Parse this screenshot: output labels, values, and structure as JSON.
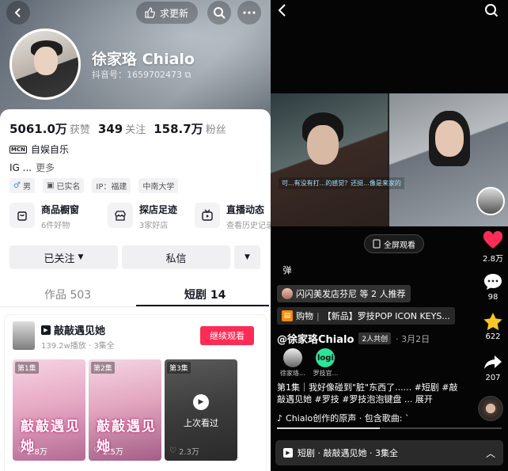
{
  "left": {
    "header": {
      "update_label": "求更新"
    },
    "profile": {
      "name": "徐家珞 Chialo",
      "douyin_id": "抖音号：1659702473",
      "stats": [
        {
          "value": "5061.0万",
          "label": "获赞"
        },
        {
          "value": "349",
          "label": "关注"
        },
        {
          "value": "158.7万",
          "label": "粉丝"
        }
      ],
      "mcn_badge": "MCN",
      "mcn": "自娱自乐",
      "bio": "IG ...",
      "bio_more": "更多",
      "tags": [
        "男",
        "已实名",
        "IP：福建",
        "中南大学"
      ]
    },
    "services": [
      {
        "title": "商品橱窗",
        "sub": "6件好物"
      },
      {
        "title": "探店足迹",
        "sub": "3家好店"
      },
      {
        "title": "直播动态",
        "sub": "查看历史记录"
      }
    ],
    "buttons": {
      "followed": "已关注",
      "message": "私信"
    },
    "tabs": [
      {
        "label": "作品 503"
      },
      {
        "label": "短剧 14"
      }
    ],
    "drama": {
      "title": "敲敲遇见她",
      "sub": "139.2w播放 · 3集全",
      "watch_label": "继续观看",
      "episodes": [
        {
          "badge": "第1集",
          "likes": "2.8万",
          "art": "敲敲遇见她"
        },
        {
          "badge": "第2集",
          "likes": "2.5万",
          "art": "敲敲遇见她"
        },
        {
          "badge": "第3集",
          "likes": "2.3万",
          "overlay": "上次看过"
        }
      ]
    }
  },
  "right": {
    "fullscreen_label": "全屏观看",
    "danmaku": "弹",
    "subtitle": "可...有没有打...的感觉？还挺...像是来家的",
    "actions": [
      {
        "icon": "heart-icon",
        "count": "2.8万"
      },
      {
        "icon": "comment-icon",
        "count": "98"
      },
      {
        "icon": "star-icon",
        "count": "622"
      },
      {
        "icon": "share-icon",
        "count": "207"
      }
    ],
    "recommend": "闪闪美发店芬尼 等 2 人推荐",
    "shop_label": "购物",
    "shop_item": "【新品】罗技POP ICON KEYS...",
    "author": "@徐家珞Chialo",
    "co_create": "2人共创",
    "date": "· 3月2日",
    "coauthors": [
      {
        "name": "徐家珞..."
      },
      {
        "name": "罗技官..."
      }
    ],
    "logi_text": "logi",
    "desc": "第1集｜我好像碰到\"脏\"东西了...... #短剧 #敲敲遇见她 #罗技 #罗技泡泡键盘 ... 展开",
    "music": "Chialo创作的原声 · 包含歌曲: `",
    "bottom": "短剧 · 敲敲遇见她 · 3集全",
    "colors": {
      "heart": "#fe2c55",
      "star": "#f8c625",
      "accent": "#fe2c55"
    }
  }
}
